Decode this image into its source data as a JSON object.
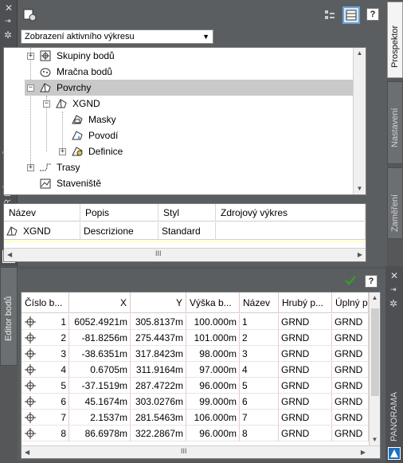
{
  "toolspace": {
    "side_title": "PROSTOR NÁSTROJŮ",
    "dropdown_value": "Zobrazení aktivního výkresu",
    "help_label": "?",
    "tree": [
      {
        "label": "Skupiny bodů",
        "icon": "point-groups-icon"
      },
      {
        "label": "Mračna bodů",
        "icon": "point-clouds-icon"
      },
      {
        "label": "Povrchy",
        "icon": "surfaces-icon"
      },
      {
        "label": "XGND",
        "icon": "surface-icon"
      },
      {
        "label": "Masky",
        "icon": "masks-icon"
      },
      {
        "label": "Povodí",
        "icon": "watersheds-icon"
      },
      {
        "label": "Definice",
        "icon": "definition-icon"
      },
      {
        "label": "Trasy",
        "icon": "alignments-icon"
      },
      {
        "label": "Staveniště",
        "icon": "sites-icon"
      }
    ],
    "list": {
      "headers": [
        "Název",
        "Popis",
        "Styl",
        "Zdrojový výkres"
      ],
      "row": [
        "XGND",
        "Descrizione",
        "Standard",
        ""
      ]
    },
    "tabs": [
      "Prospektor",
      "Nastavení",
      "Zaměření"
    ],
    "scroll_thumb_glyph": "III"
  },
  "editor": {
    "side_title": "Editor bodů",
    "right_title": "PANORAMA",
    "help_label": "?",
    "headers": [
      "Číslo b...",
      "X",
      "Y",
      "Výška b...",
      "Název",
      "Hrubý p...",
      "Úplný p..."
    ],
    "rows": [
      [
        "1",
        "6052.4921m",
        "305.8137m",
        "100.000m",
        "1",
        "GRND",
        "GRND"
      ],
      [
        "2",
        "-81.8256m",
        "275.4437m",
        "101.000m",
        "2",
        "GRND",
        "GRND"
      ],
      [
        "3",
        "-38.6351m",
        "317.8423m",
        "98.000m",
        "3",
        "GRND",
        "GRND"
      ],
      [
        "4",
        "0.6705m",
        "311.9164m",
        "97.000m",
        "4",
        "GRND",
        "GRND"
      ],
      [
        "5",
        "-37.1519m",
        "287.4722m",
        "96.000m",
        "5",
        "GRND",
        "GRND"
      ],
      [
        "6",
        "45.1674m",
        "303.0276m",
        "99.000m",
        "6",
        "GRND",
        "GRND"
      ],
      [
        "7",
        "2.1537m",
        "281.5463m",
        "106.000m",
        "7",
        "GRND",
        "GRND"
      ],
      [
        "8",
        "86.6978m",
        "322.2867m",
        "96.000m",
        "8",
        "GRND",
        "GRND"
      ]
    ],
    "scroll_thumb_glyph": "III"
  },
  "colors": {
    "palette_bg": "#555759",
    "selected_row": "#c9c9c9",
    "active_tab": "#f4f4f4",
    "accept_check": "#3a9a2a",
    "autodesk_blue": "#1d6fc0"
  }
}
